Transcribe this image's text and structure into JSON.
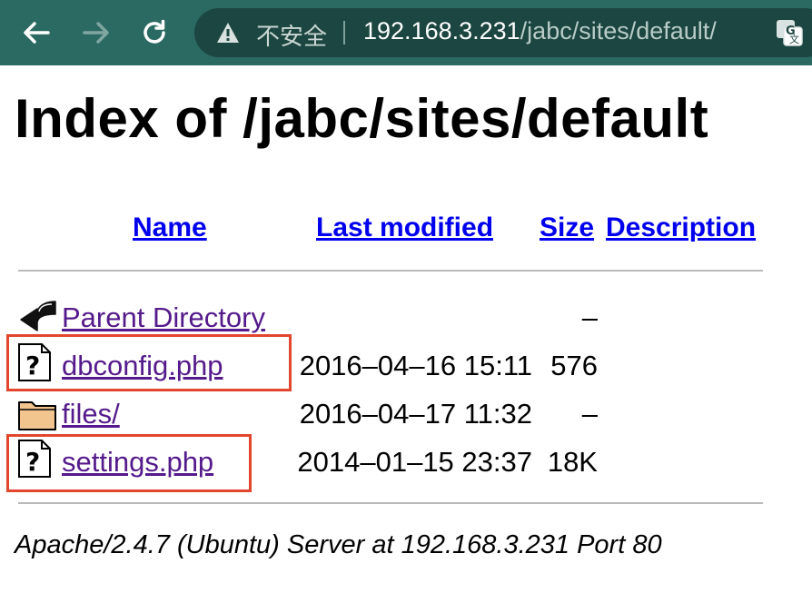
{
  "browser": {
    "security_label": "不安全",
    "url_host": "192.168.3.231",
    "url_path": "/jabc/sites/default/"
  },
  "page": {
    "title": "Index of /jabc/sites/default",
    "columns": {
      "name": "Name",
      "last_modified": "Last modified",
      "size": "Size",
      "description": "Description"
    },
    "rows": [
      {
        "name": "Parent Directory",
        "modified": "",
        "size": "–",
        "icon": "back-arrow-icon"
      },
      {
        "name": "dbconfig.php",
        "modified": "2016–04–16 15:11",
        "size": "576",
        "icon": "unknown-file-icon"
      },
      {
        "name": "files/",
        "modified": "2016–04–17 11:32",
        "size": "–",
        "icon": "folder-icon"
      },
      {
        "name": "settings.php",
        "modified": "2014–01–15 23:37",
        "size": "18K",
        "icon": "unknown-file-icon"
      }
    ],
    "footer": "Apache/2.4.7 (Ubuntu) Server at 192.168.3.231 Port 80"
  },
  "colors": {
    "toolbar": "#2b6a63",
    "link_header": "#0000ee",
    "link_visited": "#551a8b",
    "highlight_box": "#e2462c"
  }
}
